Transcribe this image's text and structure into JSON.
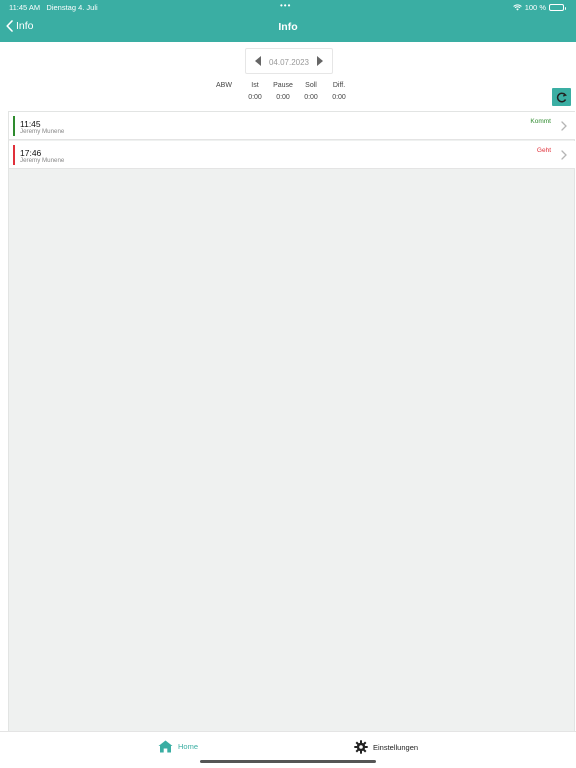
{
  "status_bar": {
    "time": "11:45 AM",
    "date": "Dienstag 4. Juli",
    "battery": "100 %",
    "battery_level": 1.0
  },
  "nav": {
    "back_label": "Info",
    "title": "Info"
  },
  "date_picker": {
    "value": "04.07.2023"
  },
  "summary": {
    "columns": [
      {
        "header": "ABW",
        "value": ""
      },
      {
        "header": "Ist",
        "value": "0:00"
      },
      {
        "header": "Pause",
        "value": "0:00"
      },
      {
        "header": "Soll",
        "value": "0:00"
      },
      {
        "header": "Diff.",
        "value": "0:00"
      }
    ]
  },
  "entries": [
    {
      "time": "11:45",
      "name": "Jeremy Munene",
      "status": "Kommt",
      "color": "#2e8b2e"
    },
    {
      "time": "17:46",
      "name": "Jeremy Munene",
      "status": "Geht",
      "color": "#e0303a"
    }
  ],
  "tabs": {
    "home": "Home",
    "settings": "Einstellungen"
  },
  "colors": {
    "accent": "#3aaea3",
    "kommt": "#2e8b2e",
    "geht": "#e0303a"
  },
  "icons": {
    "back": "chevron-left-icon",
    "wifi": "wifi-icon",
    "battery": "battery-icon",
    "refresh": "refresh-icon",
    "home": "home-icon",
    "settings": "gear-icon",
    "row_chevron": "chevron-right-icon"
  }
}
